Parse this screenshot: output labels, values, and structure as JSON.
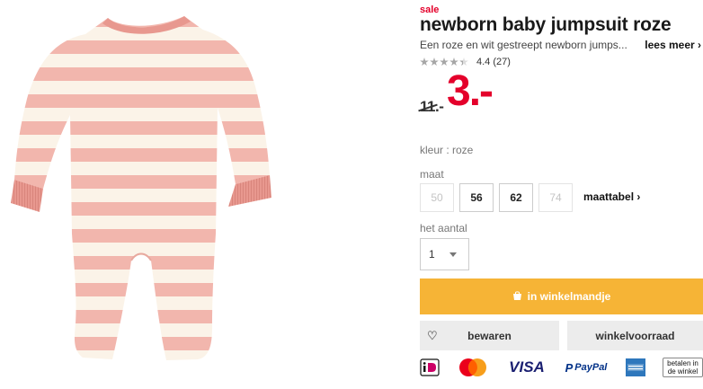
{
  "product": {
    "image_alt": "newborn baby jumpsuit roze",
    "sale_label": "sale",
    "title": "newborn baby jumpsuit roze",
    "description": "Een roze en wit gestreept newborn jumps...",
    "read_more": "lees meer ›",
    "rating_value": 4.4,
    "rating_text": "4.4 (27)",
    "old_price": "11.-",
    "new_price": "3.-",
    "color_label": "kleur : roze",
    "size_label": "maat",
    "sizes": [
      {
        "label": "50",
        "available": false
      },
      {
        "label": "56",
        "available": true
      },
      {
        "label": "62",
        "available": true
      },
      {
        "label": "74",
        "available": false
      }
    ],
    "size_chart_link": "maattabel ›",
    "quantity_label": "het aantal",
    "quantity_value": "1",
    "add_to_cart": "in winkelmandje",
    "save": "bewaren",
    "store_stock": "winkelvoorraad"
  },
  "payment_methods": [
    {
      "name": "ideal-icon",
      "label": "iD"
    },
    {
      "name": "mastercard-icon",
      "label": ""
    },
    {
      "name": "visa-icon",
      "label": "VISA"
    },
    {
      "name": "paypal-icon",
      "label": "PayPal"
    },
    {
      "name": "amex-icon",
      "label": ""
    },
    {
      "name": "pay-in-store-icon",
      "label": "betalen in de winkel"
    }
  ],
  "colors": {
    "accent_red": "#e4002b",
    "cart_button": "#f6b436",
    "secondary_button": "#ececec",
    "stripe_pink": "#f2b6ad",
    "stripe_cream": "#fbf3e8"
  }
}
